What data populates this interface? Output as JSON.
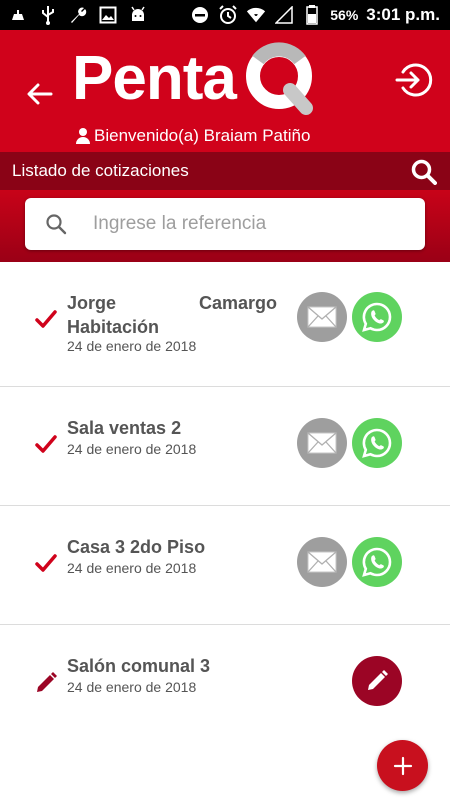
{
  "status_bar": {
    "left_icons": [
      "notification-icon",
      "usb-icon",
      "wrench-icon",
      "image-icon",
      "android-icon"
    ],
    "right_icons": [
      "do-not-disturb-icon",
      "alarm-icon",
      "wifi-icon",
      "signal-icon",
      "battery-icon"
    ],
    "battery": "56%",
    "time": "3:01 p.m."
  },
  "header": {
    "logo_text": "Penta",
    "welcome": "Bienvenido(a) Braiam Patiño",
    "color": "#d0021b"
  },
  "title_bar": {
    "title": "Listado de cotizaciones",
    "color": "#8a0316"
  },
  "search": {
    "placeholder": "Ingrese la referencia",
    "value": ""
  },
  "quotes": [
    {
      "title": "Jorge Camargo Habitación",
      "title_line1_left": "Jorge",
      "title_line1_right": "Camargo",
      "title_line2": "Habitación",
      "date": "24 de enero de 2018",
      "status": "sent"
    },
    {
      "title": "Sala ventas 2",
      "date": "24 de enero de 2018",
      "status": "sent"
    },
    {
      "title": "Casa 3 2do Piso",
      "date": "24 de enero de 2018",
      "status": "sent"
    },
    {
      "title": "Salón comunal 3",
      "date": "24 de enero de 2018",
      "status": "draft"
    }
  ],
  "colors": {
    "accent": "#d0021b",
    "whatsapp": "#5fd35f",
    "email": "#9e9e9e",
    "edit": "#9b0525",
    "check": "#d0021b"
  }
}
